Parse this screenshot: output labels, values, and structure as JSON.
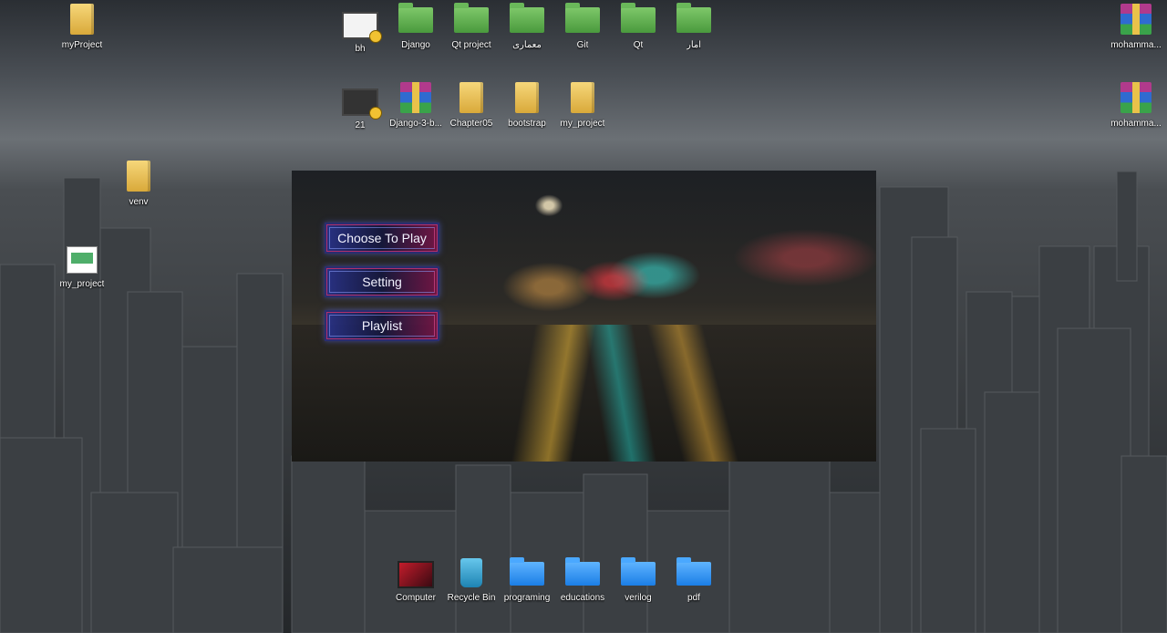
{
  "desktop": {
    "icons_top": [
      {
        "label": "myProject",
        "type": "folder-yellow"
      },
      {
        "label": "bh",
        "type": "video"
      },
      {
        "label": "Django",
        "type": "folder-green"
      },
      {
        "label": "Qt project",
        "type": "folder-green"
      },
      {
        "label": "معماری",
        "type": "folder-green"
      },
      {
        "label": "Git",
        "type": "folder-green"
      },
      {
        "label": "Qt",
        "type": "folder-green"
      },
      {
        "label": "آمار",
        "type": "folder-green"
      },
      {
        "label": "mohamma...",
        "type": "rar"
      }
    ],
    "icons_row2": [
      {
        "label": "21",
        "type": "video"
      },
      {
        "label": "Django-3-b...",
        "type": "rar"
      },
      {
        "label": "Chapter05",
        "type": "folder-yellow"
      },
      {
        "label": "bootstrap",
        "type": "folder-yellow"
      },
      {
        "label": "my_project",
        "type": "folder-yellow"
      },
      {
        "label": "mohamma...",
        "type": "rar"
      }
    ],
    "icons_left": [
      {
        "label": "venv",
        "type": "folder-yellow"
      },
      {
        "label": "my_project",
        "type": "doc"
      }
    ],
    "icons_bottom": [
      {
        "label": "Computer",
        "type": "computer"
      },
      {
        "label": "Recycle Bin",
        "type": "bin"
      },
      {
        "label": "programing",
        "type": "folder-blue"
      },
      {
        "label": "educations",
        "type": "folder-blue"
      },
      {
        "label": "verilog",
        "type": "folder-blue"
      },
      {
        "label": "pdf",
        "type": "folder-blue"
      }
    ]
  },
  "app": {
    "menu": {
      "choose_to_play": "Choose To Play",
      "setting": "Setting",
      "playlist": "Playlist"
    }
  }
}
